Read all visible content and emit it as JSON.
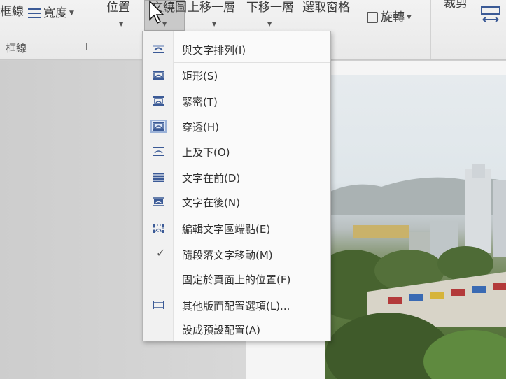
{
  "ribbon": {
    "border_label": "框線",
    "width_label": "寬度",
    "position_label": "位置",
    "wrap_text_label": "文繞圖",
    "bring_forward_label": "上移一層",
    "send_backward_label": "下移一層",
    "selection_pane_label": "選取窗格",
    "rotate_label": "旋轉",
    "crop_label": "裁剪",
    "border_group_label": "框線"
  },
  "wrap_menu": {
    "items": [
      {
        "label": "與文字排列(I)",
        "icon": "wrap-inline-icon"
      },
      {
        "label": "矩形(S)",
        "icon": "wrap-square-icon"
      },
      {
        "label": "緊密(T)",
        "icon": "wrap-tight-icon"
      },
      {
        "label": "穿透(H)",
        "icon": "wrap-through-icon"
      },
      {
        "label": "上及下(O)",
        "icon": "wrap-top-bottom-icon"
      },
      {
        "label": "文字在前(D)",
        "icon": "wrap-behind-text-icon"
      },
      {
        "label": "文字在後(N)",
        "icon": "wrap-in-front-icon"
      },
      {
        "label": "編輯文字區端點(E)",
        "icon": "edit-wrap-points-icon"
      },
      {
        "label": "隨段落文字移動(M)",
        "icon": "checkmark-icon",
        "checked": true
      },
      {
        "label": "固定於頁面上的位置(F)",
        "icon": ""
      },
      {
        "label": "其他版面配置選項(L)...",
        "icon": "layout-options-icon"
      },
      {
        "label": "設成預設配置(A)",
        "icon": ""
      }
    ]
  },
  "colors": {
    "icon_blue": "#3b5a96",
    "ribbon_bg": "#f0f0f0",
    "menu_bg": "#fafafa"
  }
}
